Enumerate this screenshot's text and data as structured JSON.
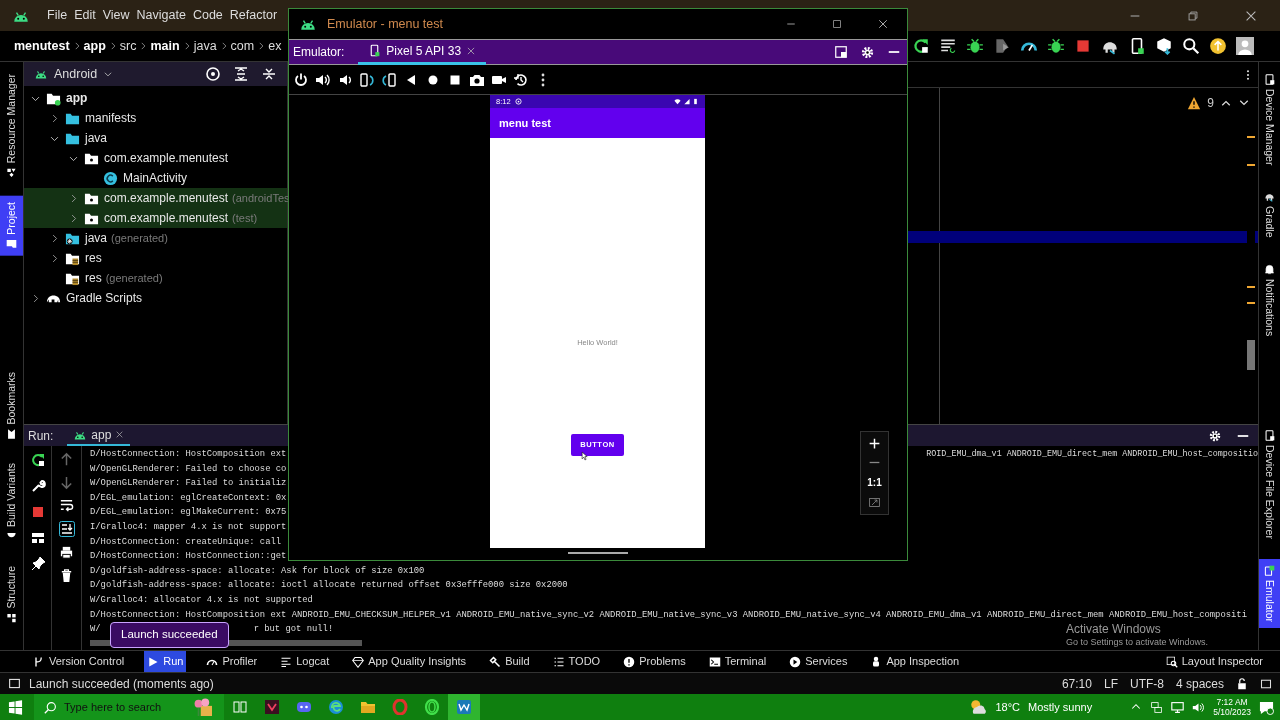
{
  "ide": {
    "menu": [
      "File",
      "Edit",
      "View",
      "Navigate",
      "Code",
      "Refactor"
    ],
    "breadcrumb": [
      {
        "label": "menutest",
        "bold": true
      },
      {
        "label": "app",
        "bold": true
      },
      {
        "label": "src",
        "bold": false
      },
      {
        "label": "main",
        "bold": true
      },
      {
        "label": "java",
        "bold": false
      },
      {
        "label": "com",
        "bold": false
      },
      {
        "label": "ex",
        "bold": false
      }
    ]
  },
  "left_stripe": {
    "top": [
      {
        "label": "Resource Manager",
        "selected": false
      },
      {
        "label": "Project",
        "selected": true
      }
    ],
    "bottom": [
      {
        "label": "Bookmarks",
        "selected": false
      },
      {
        "label": "Build Variants",
        "selected": false
      },
      {
        "label": "Structure",
        "selected": false
      }
    ]
  },
  "right_stripe": {
    "top": [
      {
        "label": "Device Manager",
        "selected": false
      },
      {
        "label": "Gradle",
        "selected": false
      },
      {
        "label": "Notifications",
        "selected": false
      }
    ],
    "bottom": [
      {
        "label": "Device File Explorer",
        "selected": false
      },
      {
        "label": "Emulator",
        "selected": true
      }
    ]
  },
  "project_panel": {
    "view": "Android",
    "tree": [
      {
        "label": "app",
        "kind": "module",
        "expanded": true,
        "highlighted": false,
        "bold": true,
        "children": [
          {
            "label": "manifests",
            "kind": "folder",
            "expanded": false,
            "highlighted": false,
            "bold": false
          },
          {
            "label": "java",
            "kind": "folder",
            "expanded": true,
            "highlighted": false,
            "bold": false,
            "children": [
              {
                "label": "com.example.menutest",
                "kind": "package",
                "expanded": true,
                "highlighted": false,
                "bold": false,
                "children": [
                  {
                    "label": "MainActivity",
                    "kind": "class",
                    "highlighted": false,
                    "bold": false
                  }
                ]
              },
              {
                "label": "com.example.menutest",
                "suffix": "(androidTes",
                "kind": "package",
                "expanded": false,
                "highlighted": true,
                "bold": false
              },
              {
                "label": "com.example.menutest",
                "suffix": "(test)",
                "kind": "package",
                "expanded": false,
                "highlighted": true,
                "bold": false
              }
            ]
          },
          {
            "label": "java",
            "suffix": "(generated)",
            "kind": "generated",
            "expanded": false,
            "highlighted": false,
            "bold": false
          },
          {
            "label": "res",
            "kind": "resources",
            "expanded": false,
            "highlighted": false,
            "bold": false
          },
          {
            "label": "res",
            "suffix": "(generated)",
            "kind": "resources",
            "highlighted": false,
            "bold": false
          }
        ]
      },
      {
        "label": "Gradle Scripts",
        "kind": "gradle",
        "expanded": false,
        "highlighted": false,
        "bold": false
      }
    ]
  },
  "editor": {
    "warnings": "9"
  },
  "run_panel": {
    "label": "Run:",
    "tabs": [
      {
        "label": "app",
        "selected": true
      }
    ],
    "log": [
      {
        "kind": "split",
        "text": "D/HostConnection: HostComposition ext",
        "right": "ROID_EMU_dma_v1 ANDROID_EMU_direct_mem ANDROID_EMU_host_compositio"
      },
      {
        "kind": "split",
        "text": "W/OpenGLRenderer: Failed to choose co"
      },
      {
        "kind": "split",
        "text": "W/OpenGLRenderer: Failed to initializ"
      },
      {
        "kind": "split",
        "text": "D/EGL_emulation: eglCreateContext: 0x"
      },
      {
        "kind": "split",
        "text": "D/EGL_emulation: eglMakeCurrent: 0x75"
      },
      {
        "kind": "split",
        "text": "I/Gralloc4: mapper 4.x is not support"
      },
      {
        "kind": "split",
        "text": "D/HostConnection: createUnique: call"
      },
      {
        "kind": "split",
        "text": "D/HostConnection: HostConnection::get"
      },
      {
        "kind": "full",
        "text": "D/goldfish-address-space: allocate: Ask for block of size 0x100"
      },
      {
        "kind": "full",
        "text": "D/goldfish-address-space: allocate: ioctl allocate returned offset 0x3efffe000 size 0x2000"
      },
      {
        "kind": "full",
        "text": "W/Gralloc4: allocator 4.x is not supported"
      },
      {
        "kind": "full",
        "text": "D/HostConnection: HostComposition ext ANDROID_EMU_CHECKSUM_HELPER_v1 ANDROID_EMU_native_sync_v2 ANDROID_EMU_native_sync_v3 ANDROID_EMU_native_sync_v4 ANDROID_EMU_dma_v1 ANDROID_EMU_direct_mem ANDROID_EMU_host_compositi"
      },
      {
        "kind": "toasted",
        "text": "W/",
        "right": "r but got null!"
      }
    ],
    "toast": "Launch succeeded"
  },
  "tool_windows": [
    {
      "label": "Version Control",
      "selected": false
    },
    {
      "label": "Run",
      "selected": true
    },
    {
      "label": "Profiler",
      "selected": false
    },
    {
      "label": "Logcat",
      "selected": false
    },
    {
      "label": "App Quality Insights",
      "selected": false
    },
    {
      "label": "Build",
      "selected": false
    },
    {
      "label": "TODO",
      "selected": false
    },
    {
      "label": "Problems",
      "selected": false
    },
    {
      "label": "Terminal",
      "selected": false
    },
    {
      "label": "Services",
      "selected": false
    },
    {
      "label": "App Inspection",
      "selected": false
    }
  ],
  "tool_windows_right": [
    {
      "label": "Layout Inspector",
      "selected": false
    }
  ],
  "activation_notice": {
    "title": "Activate Windows",
    "text": "Go to Settings to activate Windows."
  },
  "status_bar": {
    "message": "Launch succeeded (moments ago)",
    "items": [
      "67:10",
      "LF",
      "UTF-8",
      "4 spaces"
    ]
  },
  "emulator": {
    "title": "Emulator - menu test",
    "label": "Emulator:",
    "tabs": [
      {
        "label": "Pixel 5 API 33",
        "selected": true
      }
    ],
    "device": {
      "time": "8:12",
      "app_title": "menu test",
      "text": "Hello World!",
      "button": "BUTTON"
    },
    "zoom_label": "1:1"
  },
  "taskbar": {
    "search_placeholder": "Type here to search",
    "temperature": "18°C",
    "weather": "Mostly sunny",
    "time": "7:12 AM",
    "date": "5/10/2023"
  }
}
